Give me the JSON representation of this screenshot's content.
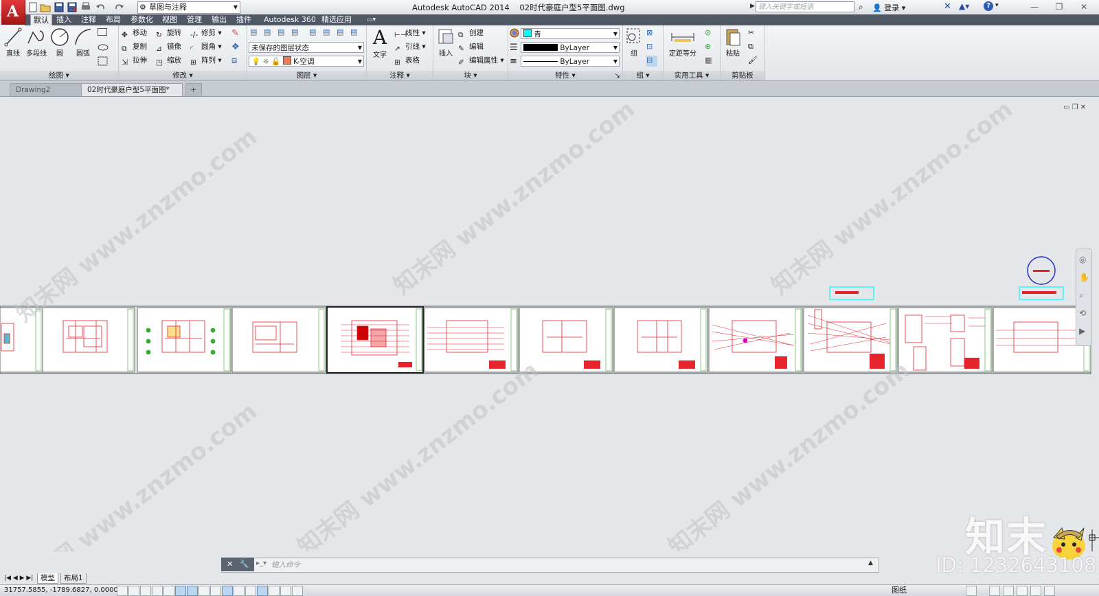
{
  "app": {
    "title": "Autodesk AutoCAD 2014",
    "filename": "02时代豪庭户型5平面图.dwg",
    "workspace": "草图与注释",
    "search_placeholder": "键入关键字或短语",
    "login_label": "登录",
    "logo_letter": "A"
  },
  "ribbon_tabs": [
    "默认",
    "插入",
    "注释",
    "布局",
    "参数化",
    "视图",
    "管理",
    "输出",
    "插件",
    "Autodesk 360",
    "精选应用"
  ],
  "panels": {
    "draw": {
      "title": "绘图",
      "line": "直线",
      "polyline": "多段线",
      "circle": "圆",
      "arc": "圆弧"
    },
    "modify": {
      "title": "修改",
      "move": "移动",
      "rotate": "旋转",
      "trim": "修剪",
      "copy": "复制",
      "mirror": "镜像",
      "fillet": "圆角",
      "stretch": "拉伸",
      "scale": "缩放",
      "array": "阵列"
    },
    "layers": {
      "title": "图层",
      "state": "未保存的图层状态",
      "current": "K-空调"
    },
    "annotation": {
      "title": "注释",
      "text": "文字",
      "linear": "线性",
      "leader": "引线",
      "table": "表格"
    },
    "block": {
      "title": "块",
      "insert": "插入",
      "create": "创建",
      "edit": "编辑",
      "edit_attr": "编辑属性"
    },
    "properties": {
      "title": "特性",
      "color": "青",
      "lineweight": "ByLayer",
      "linetype": "ByLayer"
    },
    "groups": {
      "title": "组",
      "group": "组"
    },
    "utilities": {
      "title": "实用工具",
      "measure": "定距等分"
    },
    "clipboard": {
      "title": "剪贴板",
      "paste": "粘贴"
    }
  },
  "file_tabs": [
    "Drawing2",
    "02时代豪庭户型5平面图*"
  ],
  "command_line": {
    "placeholder": "键入命令"
  },
  "layout_tabs": [
    "模型",
    "布局1"
  ],
  "status": {
    "coordinates": "31757.5855, -1789.6827, 0.0000",
    "paper": "图纸"
  },
  "watermark": {
    "brand": "知末",
    "site": "知末网 www.znzmo.com",
    "id": "ID: 1232643108"
  },
  "colors": {
    "accent_red": "#e6222a",
    "ribbon_dark": "#4f5864",
    "canvas": "#e4e6ea",
    "color_swatch_cyan": "#00ffff"
  }
}
